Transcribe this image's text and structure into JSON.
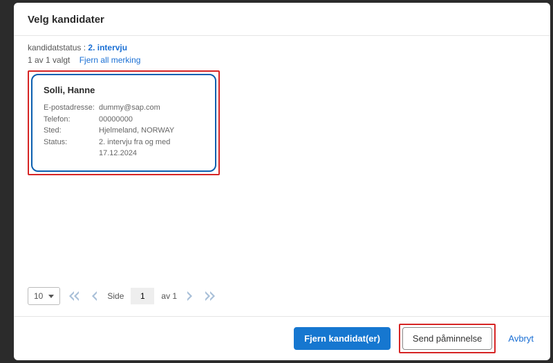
{
  "dialog": {
    "title": "Velg kandidater"
  },
  "status": {
    "label": "kandidatstatus :",
    "value": "2. intervju"
  },
  "selection": {
    "summary": "1 av 1 valgt",
    "deselect_label": "Fjern all merking"
  },
  "candidate": {
    "name": "Solli, Hanne",
    "fields": {
      "email_label": "E-postadresse:",
      "email_value": "dummy@sap.com",
      "phone_label": "Telefon:",
      "phone_value": "00000000",
      "location_label": "Sted:",
      "location_value": "Hjelmeland, NORWAY",
      "status_label": "Status:",
      "status_value": "2. intervju fra og med 17.12.2024"
    }
  },
  "pagination": {
    "page_size": "10",
    "side_label": "Side",
    "current_page": "1",
    "total_label": "av 1"
  },
  "footer": {
    "remove_label": "Fjern kandidat(er)",
    "send_label": "Send påminnelse",
    "cancel_label": "Avbryt"
  }
}
